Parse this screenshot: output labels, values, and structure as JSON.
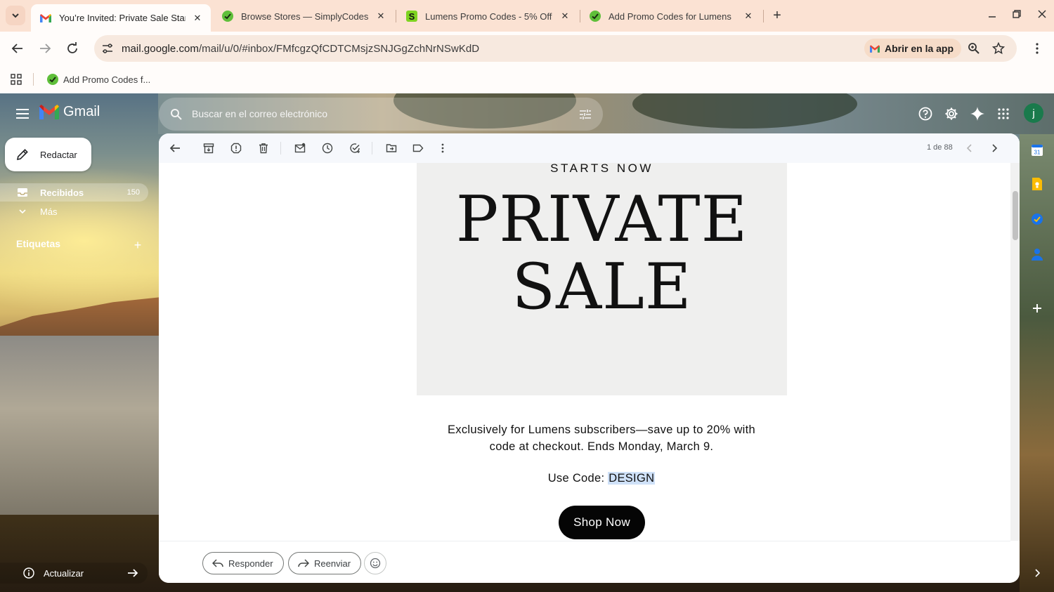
{
  "browser": {
    "tabs": [
      {
        "title": "You’re Invited: Private Sale Star",
        "favicon": "gmail-icon",
        "active": true
      },
      {
        "title": "Browse Stores — SimplyCodes",
        "favicon": "simplycodes-icon",
        "active": false
      },
      {
        "title": "Lumens Promo Codes - 5% Off",
        "favicon": "s-logo-icon",
        "active": false
      },
      {
        "title": "Add Promo Codes for Lumens",
        "favicon": "simplycodes-icon",
        "active": false
      }
    ],
    "url_host": "mail.google.com",
    "url_path": "/mail/u/0/#inbox/FMfcgzQfCDTCMsjzSNJGgZchNrNSwKdD",
    "open_in_app": "Abrir en la app",
    "bookmark": "Add Promo Codes f..."
  },
  "gmail": {
    "logo_text": "Gmail",
    "search_placeholder": "Buscar en el correo electrónico",
    "avatar_letter": "j",
    "compose": "Redactar",
    "nav": [
      {
        "label": "Recibidos",
        "count": "150",
        "selected": true
      },
      {
        "label": "Más",
        "selected": false
      }
    ],
    "labels_header": "Etiquetas",
    "update_label": "Actualizar",
    "pager": "1 de 88"
  },
  "email": {
    "kicker": "STARTS NOW",
    "title_line1": "PRIVATE",
    "title_line2": "SALE",
    "body_line1": "Exclusively for Lumens subscribers—save up to 20% with",
    "body_line2": "code at checkout. Ends Monday, March 9.",
    "code_prefix": "Use Code: ",
    "code": "DESIGN",
    "cta": "Shop Now"
  },
  "reply": {
    "reply_label": "Responder",
    "forward_label": "Reenviar"
  },
  "colors": {
    "tabstrip_bg": "#fbe2d3",
    "accent_highlight": "#cfe1f8",
    "cta_bg": "#050505",
    "avatar_bg": "#1a7a4c"
  }
}
